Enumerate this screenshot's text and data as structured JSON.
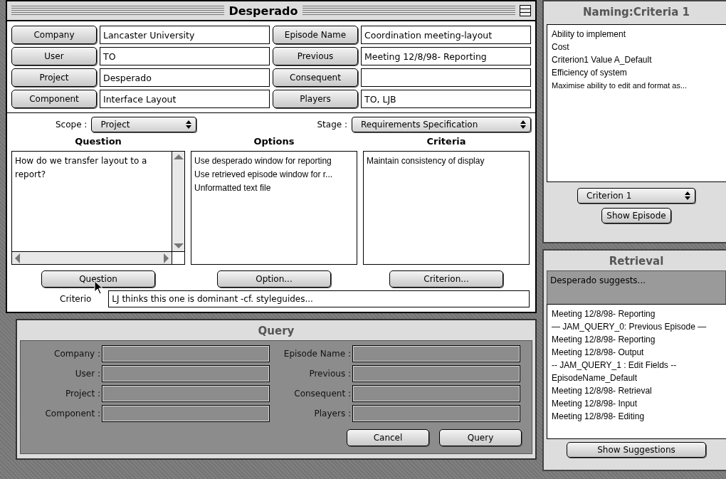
{
  "main_window": {
    "title": "Desperado",
    "fields": [
      {
        "label": "Company",
        "value": "Lancaster University"
      },
      {
        "label": "Episode Name",
        "value": "Coordination meeting-layout"
      },
      {
        "label": "User",
        "value": "TO"
      },
      {
        "label": "Previous",
        "value": "Meeting 12/8/98- Reporting"
      },
      {
        "label": "Project",
        "value": "Desperado"
      },
      {
        "label": "Consequent"
      },
      {
        "label": "Component",
        "value": "Interface Layout"
      },
      {
        "label": "Players",
        "value": "TO, LJB"
      }
    ],
    "scope": {
      "label": "Scope :",
      "value": "Project"
    },
    "stage": {
      "label": "Stage :",
      "value": "Requirements Specification"
    },
    "question": {
      "heading": "Question",
      "text": "How do we transfer layout to a report?",
      "button": "Question"
    },
    "options": {
      "heading": "Options",
      "items": [
        "Use desperado window for reporting",
        "Use retrieved episode window for r...",
        "Unformatted text file"
      ],
      "button": "Option..."
    },
    "criteria": {
      "heading": "Criteria",
      "items": [
        "Maintain consistency of display"
      ],
      "button": "Criterion..."
    },
    "note": {
      "label": "Criterio",
      "value": "LJ thinks this one is dominant -cf. styleguides..."
    }
  },
  "query_window": {
    "title": "Query",
    "fields": [
      {
        "label": "Company :"
      },
      {
        "label": "Episode Name :"
      },
      {
        "label": "User :"
      },
      {
        "label": "Previous :"
      },
      {
        "label": "Project :"
      },
      {
        "label": "Consequent :"
      },
      {
        "label": "Component :"
      },
      {
        "label": "Players :"
      }
    ],
    "buttons": [
      "Cancel",
      "Query"
    ]
  },
  "naming_window": {
    "title": "Naming:Criteria 1",
    "items": [
      "Ability to implement",
      "Cost",
      "Criterion1 Value A_Default",
      "Efficiency of system",
      "Maximise ability to edit and format as..."
    ],
    "select": "Criterion 1",
    "button": "Show Episode"
  },
  "retrieval_window": {
    "title": "Retrieval",
    "message": "Desperado suggests...",
    "items": [
      "Meeting 12/8/98- Reporting",
      "— JAM_QUERY_0: Previous Episode —",
      "Meeting 12/8/98- Reporting",
      "Meeting 12/8/98- Output",
      "-- JAM_QUERY_1 : Edit Fields --",
      "EpisodeName_Default",
      "Meeting 12/8/98- Retrieval",
      "Meeting 12/8/98- Input",
      "Meeting 12/8/98- Editing"
    ],
    "button": "Show Suggestions"
  }
}
